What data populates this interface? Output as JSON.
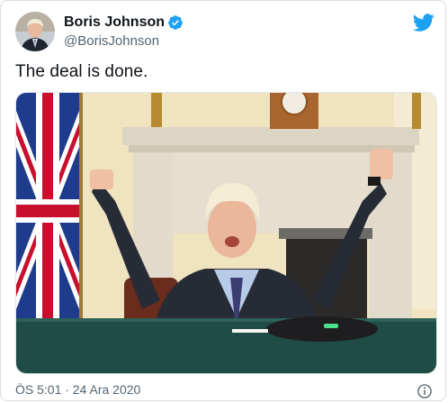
{
  "tweet": {
    "author_name": "Boris Johnson",
    "handle": "@BorisJohnson",
    "text": "The deal is done.",
    "timestamp": "ÖS 5:01 · 24 Ara 2020",
    "verified": true
  },
  "icons": {
    "brand": "twitter-bird-icon",
    "verified": "verified-badge-icon",
    "info": "info-icon"
  },
  "colors": {
    "twitter_blue": "#1da1f2",
    "secondary_text": "#536471",
    "primary_text": "#0f1419"
  }
}
